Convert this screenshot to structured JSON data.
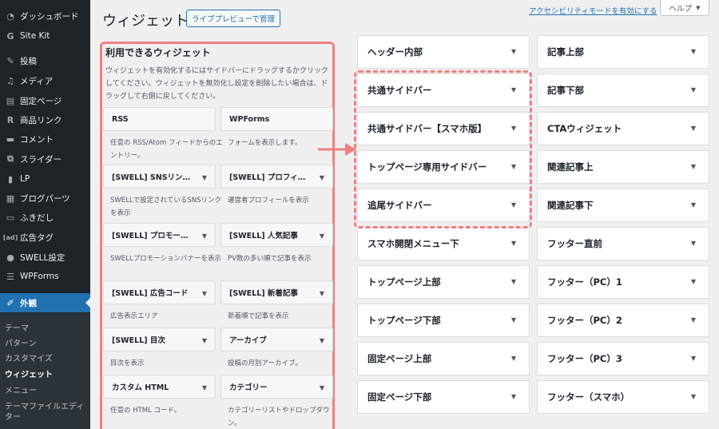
{
  "sidebar": {
    "items": [
      {
        "label": "ダッシュボード",
        "icon": "dashboard-icon"
      },
      {
        "label": "Site Kit",
        "icon": "sitekit-icon"
      },
      {
        "label": "投稿",
        "icon": "pin-icon"
      },
      {
        "label": "メディア",
        "icon": "media-icon"
      },
      {
        "label": "固定ページ",
        "icon": "page-icon"
      },
      {
        "label": "商品リンク",
        "icon": "rinker-icon"
      },
      {
        "label": "コメント",
        "icon": "comment-icon"
      },
      {
        "label": "スライダー",
        "icon": "slider-icon"
      },
      {
        "label": "LP",
        "icon": "lp-icon"
      },
      {
        "label": "ブログパーツ",
        "icon": "blogparts-icon"
      },
      {
        "label": "ふきだし",
        "icon": "balloon-icon"
      },
      {
        "label": "広告タグ",
        "icon": "ad-icon"
      },
      {
        "label": "SWELL設定",
        "icon": "swell-icon"
      },
      {
        "label": "WPForms",
        "icon": "wpforms-icon"
      },
      {
        "label": "外観",
        "icon": "brush-icon"
      }
    ],
    "submenu": [
      "テーマ",
      "パターン",
      "カスタマイズ",
      "ウィジェット",
      "メニュー",
      "テーマファイルエディ",
      "ター"
    ]
  },
  "header": {
    "title": "ウィジェット",
    "live_preview": "ライブプレビューで管理",
    "a11y_link": "アクセシビリティモードを有効にする",
    "help": "ヘルプ"
  },
  "available": {
    "title": "利用できるウィジェット",
    "description": "ウィジェットを有効化するにはサイドバーにドラッグするかクリックしてください。ウィジェットを無効化し設定を削除したい場合は、ドラッグして右側に戻してください。",
    "widgets": [
      {
        "name": "RSS",
        "desc": "任意の RSS/Atom フィードからのエントリー。"
      },
      {
        "name": "WPForms",
        "desc": "フォームを表示します。"
      },
      {
        "name": "[SWELL] SNSリン…",
        "desc": "SWELLで設定されているSNSリンクを表示"
      },
      {
        "name": "[SWELL] プロフィ…",
        "desc": "運営者プロフィールを表示"
      },
      {
        "name": "[SWELL] プロモー…",
        "desc": "SWELLプロモーションバナーを表示"
      },
      {
        "name": "[SWELL] 人気記事",
        "desc": "PV数の多い順で記事を表示"
      },
      {
        "name": "[SWELL] 広告コード",
        "desc": "広告表示エリア"
      },
      {
        "name": "[SWELL] 新着記事",
        "desc": "新着順で記事を表示"
      },
      {
        "name": "[SWELL] 目次",
        "desc": "目次を表示"
      },
      {
        "name": "アーカイブ",
        "desc": "投稿の月別アーカイブ。"
      },
      {
        "name": "カスタム HTML",
        "desc": "任意の HTML コード。"
      },
      {
        "name": "カテゴリー",
        "desc": "カテゴリーリストやドロップダウン。"
      }
    ]
  },
  "areas_left": [
    "ヘッダー内部",
    "共通サイドバー",
    "共通サイドバー【スマホ版】",
    "トップページ専用サイドバー",
    "追尾サイドバー",
    "スマホ開閉メニュー下",
    "トップページ上部",
    "トップページ下部",
    "固定ページ上部",
    "固定ページ下部"
  ],
  "areas_right": [
    "記事上部",
    "記事下部",
    "CTAウィジェット",
    "関連記事上",
    "関連記事下",
    "フッター直前",
    "フッター（PC）1",
    "フッター（PC）2",
    "フッター（PC）3",
    "フッター（スマホ）"
  ],
  "colors": {
    "accent": "#2271b1",
    "highlight": "#f08080",
    "sidebar_bg": "#1d2327"
  }
}
